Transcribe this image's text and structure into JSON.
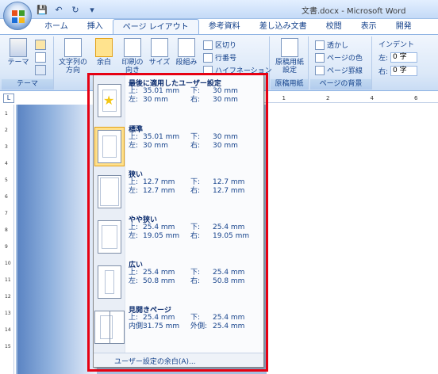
{
  "window": {
    "title": "文書.docx - Microsoft Word"
  },
  "quick_access": [
    "save-icon",
    "undo-icon",
    "redo-icon",
    "customize-icon"
  ],
  "tabs": [
    {
      "label": "ホーム"
    },
    {
      "label": "挿入"
    },
    {
      "label": "ページ レイアウト",
      "active": true
    },
    {
      "label": "参考資料"
    },
    {
      "label": "差し込み文書"
    },
    {
      "label": "校閲"
    },
    {
      "label": "表示"
    },
    {
      "label": "開発"
    }
  ],
  "ribbon": {
    "theme_group": {
      "theme_label": "テーマ",
      "group_label": "テーマ"
    },
    "page_setup": {
      "text_direction": "文字列の方向",
      "margins": "余白",
      "orientation": "印刷の向き",
      "size": "サイズ",
      "columns": "段組み",
      "breaks": "区切り",
      "line_numbers": "行番号",
      "hyphenation": "ハイフネーション"
    },
    "manuscript": {
      "button_label": "原稿用紙設定",
      "group_label": "原稿用紙"
    },
    "page_background": {
      "watermark": "透かし",
      "page_color": "ページの色",
      "page_border": "ページ罫線",
      "group_label": "ページの背景"
    },
    "indent": {
      "title": "インデント",
      "left_label": "左:",
      "left_value": "0 字",
      "right_label": "右:",
      "right_value": "0 字"
    }
  },
  "margins_menu": {
    "presets": [
      {
        "name": "最後に適用したユーザー設定",
        "top": "35.01 mm",
        "bottom": "30 mm",
        "left": "30 mm",
        "right": "30 mm",
        "label_top": "上:",
        "label_bottom": "下:",
        "label_left": "左:",
        "label_right": "右:",
        "selected": false
      },
      {
        "name": "標準",
        "top": "35.01 mm",
        "bottom": "30 mm",
        "left": "30 mm",
        "right": "30 mm",
        "label_top": "上:",
        "label_bottom": "下:",
        "label_left": "左:",
        "label_right": "右:",
        "selected": true
      },
      {
        "name": "狭い",
        "top": "12.7 mm",
        "bottom": "12.7 mm",
        "left": "12.7 mm",
        "right": "12.7 mm",
        "label_top": "上:",
        "label_bottom": "下:",
        "label_left": "左:",
        "label_right": "右:",
        "selected": false
      },
      {
        "name": "やや狭い",
        "top": "25.4 mm",
        "bottom": "25.4 mm",
        "left": "19.05 mm",
        "right": "19.05 mm",
        "label_top": "上:",
        "label_bottom": "下:",
        "label_left": "左:",
        "label_right": "右:",
        "selected": false
      },
      {
        "name": "広い",
        "top": "25.4 mm",
        "bottom": "25.4 mm",
        "left": "50.8 mm",
        "right": "50.8 mm",
        "label_top": "上:",
        "label_bottom": "下:",
        "label_left": "左:",
        "label_right": "右:",
        "selected": false
      },
      {
        "name": "見開きページ",
        "top": "25.4 mm",
        "bottom": "25.4 mm",
        "left": "31.75 mm",
        "right": "25.4 mm",
        "label_top": "上:",
        "label_bottom": "下:",
        "label_left": "内側:",
        "label_right": "外側:",
        "selected": false
      }
    ],
    "custom_label": "ユーザー設定の余白(A)..."
  },
  "ruler": {
    "h_ticks": [
      "1",
      "2",
      "4",
      "6"
    ],
    "v_ticks": [
      "1",
      "2",
      "3",
      "4",
      "5",
      "6",
      "7",
      "8",
      "9",
      "10",
      "11",
      "12",
      "13",
      "14",
      "15"
    ]
  },
  "colors": {
    "accent": "#15428b",
    "highlight": "#e60012",
    "selection": "#ffe08a"
  }
}
